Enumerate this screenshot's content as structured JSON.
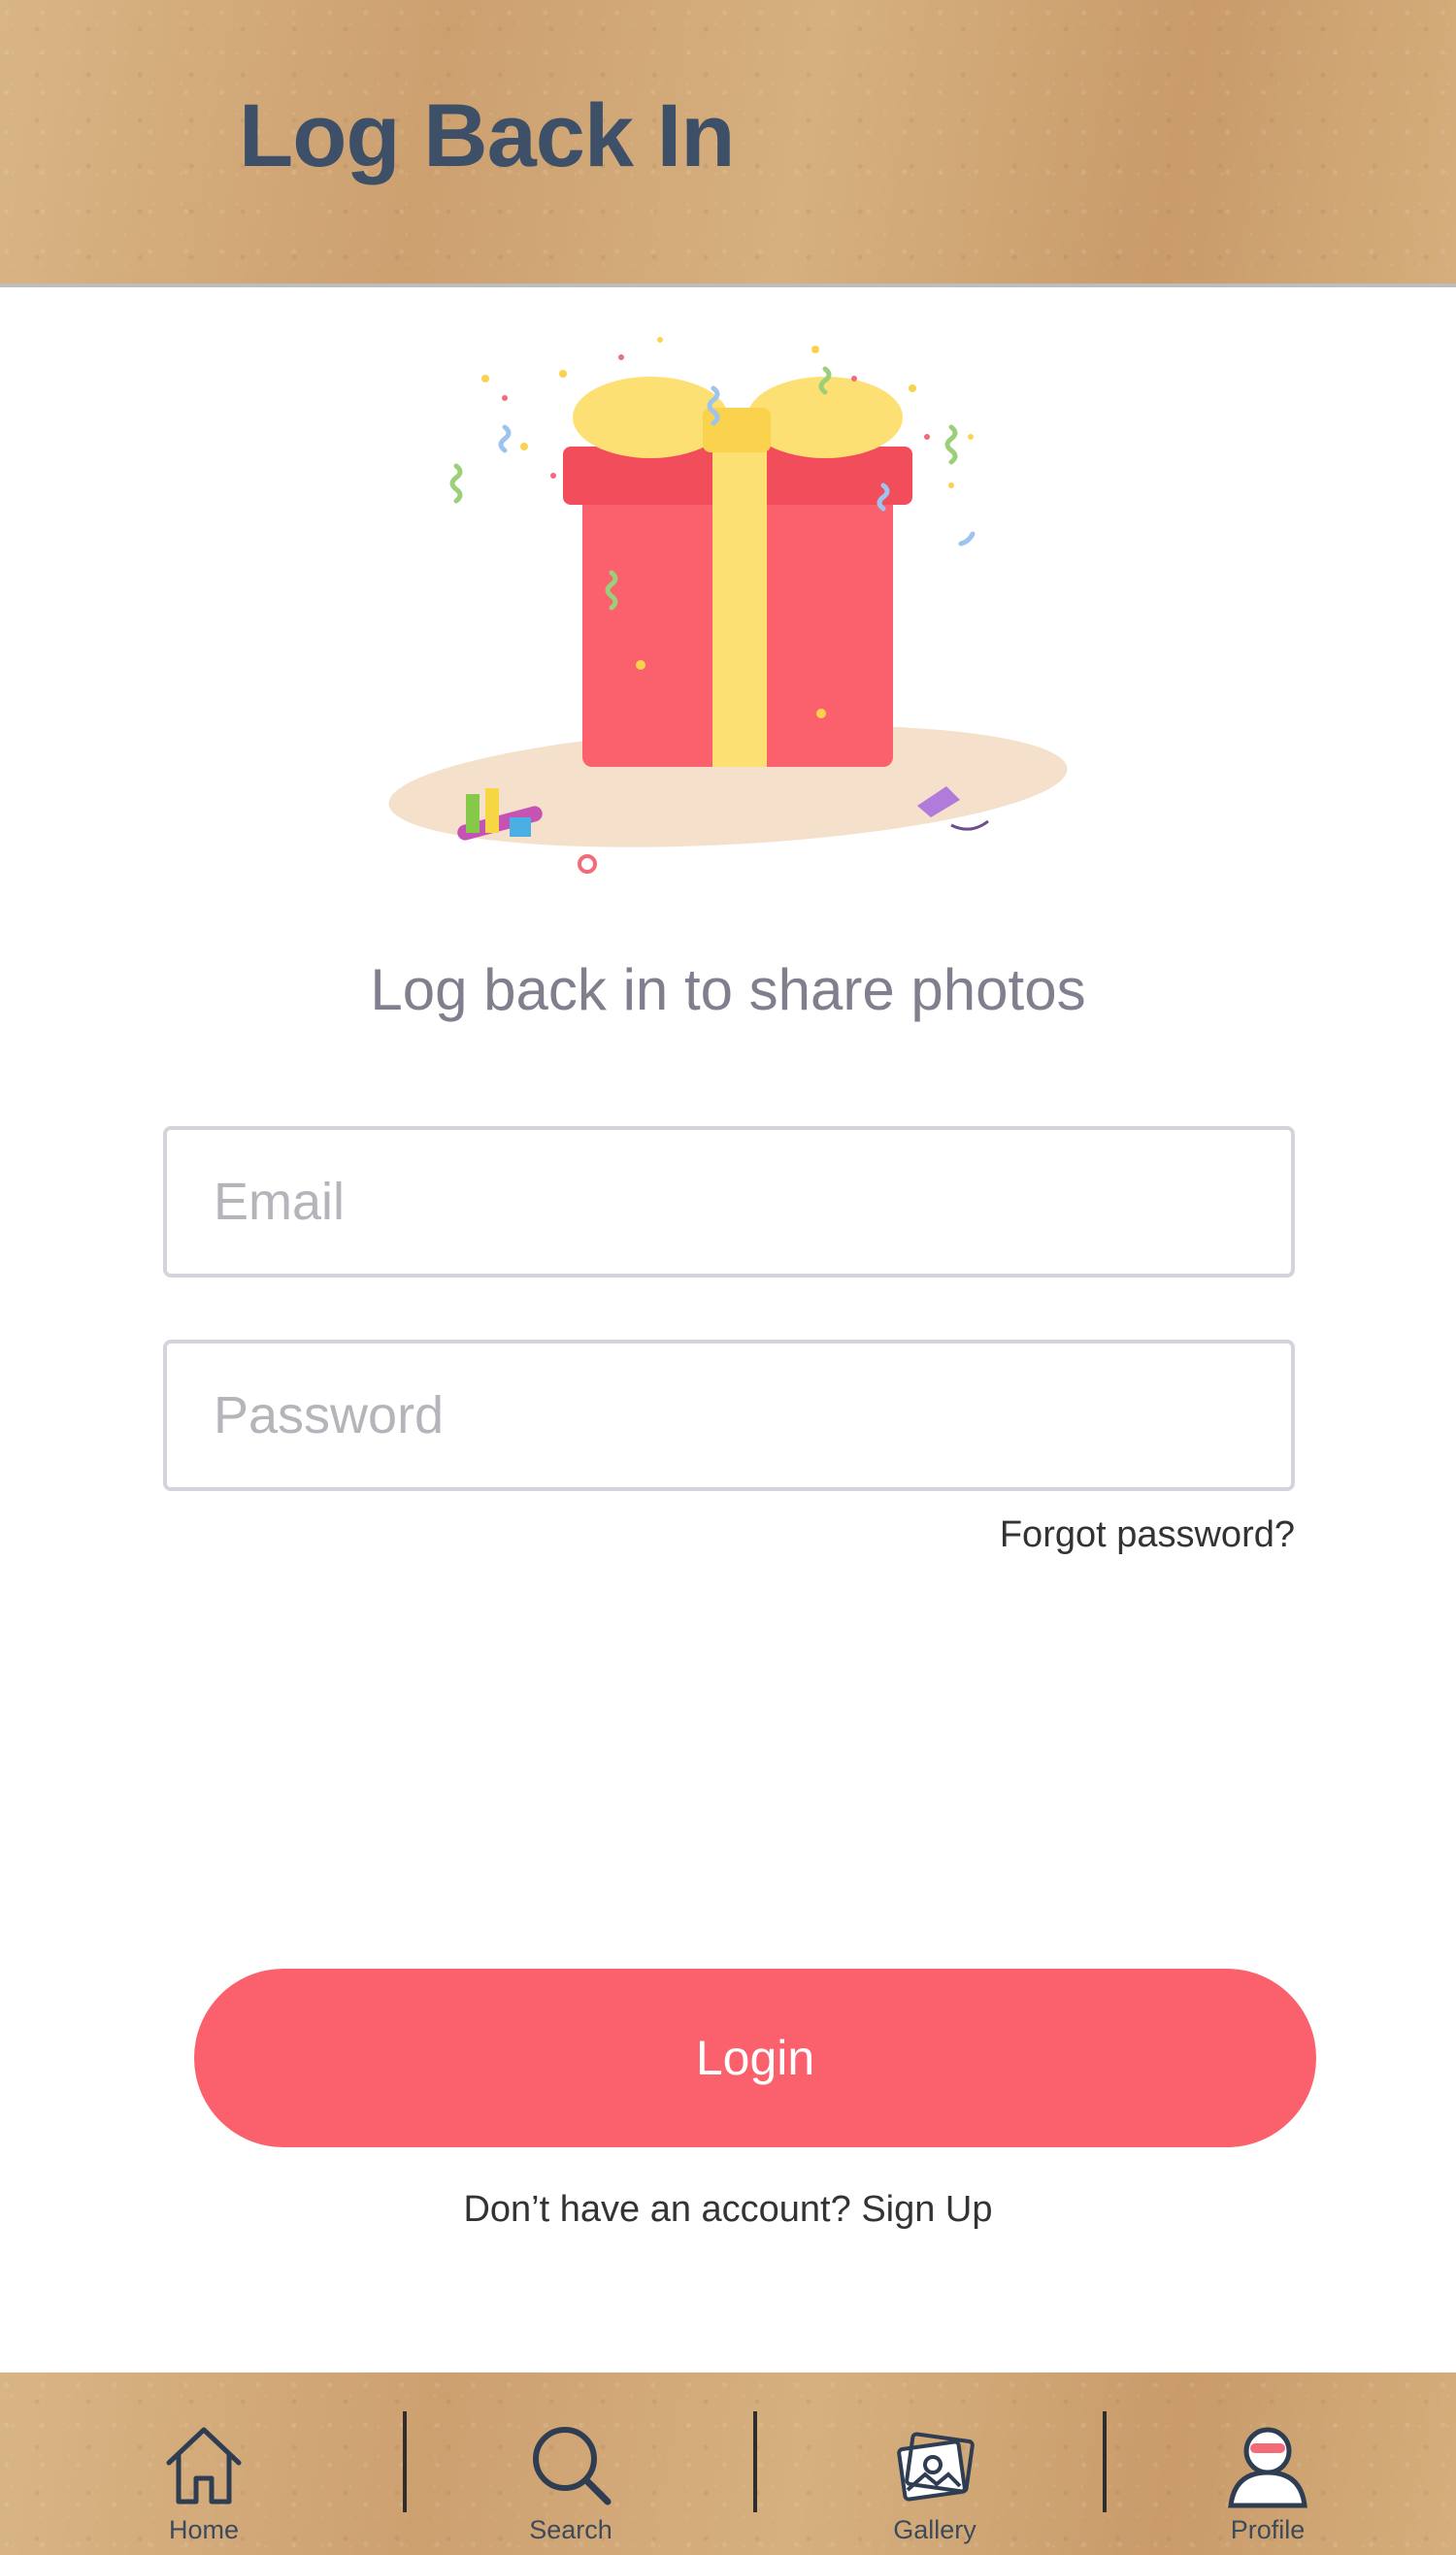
{
  "header": {
    "title": "Log Back In"
  },
  "hero": {
    "illustration": "gift-box-confetti-illustration"
  },
  "form": {
    "subtitle": "Log back in to share photos",
    "email_placeholder": "Email",
    "password_placeholder": "Password",
    "forgot_label": "Forgot password?",
    "login_label": "Login",
    "signup_prompt": "Don’t have an account?",
    "signup_link": "Sign Up"
  },
  "tabbar": {
    "tabs": [
      {
        "label": "Home",
        "icon": "home-icon"
      },
      {
        "label": "Search",
        "icon": "search-icon"
      },
      {
        "label": "Gallery",
        "icon": "gallery-icon"
      },
      {
        "label": "Profile",
        "icon": "profile-avatar-icon"
      }
    ]
  },
  "colors": {
    "title": "#3d5068",
    "accent": "#fa616d",
    "subtitle": "#7f7f8e",
    "kraft": "#d2aa76"
  }
}
